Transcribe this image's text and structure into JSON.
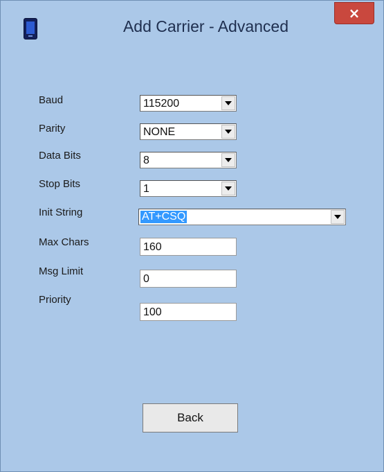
{
  "window": {
    "title": "Add Carrier - Advanced",
    "icon": "phone-app-icon",
    "close_label": "×"
  },
  "form": {
    "baud": {
      "label": "Baud",
      "value": "115200"
    },
    "parity": {
      "label": "Parity",
      "value": "NONE"
    },
    "data_bits": {
      "label": "Data Bits",
      "value": "8"
    },
    "stop_bits": {
      "label": "Stop Bits",
      "value": "1"
    },
    "init_string": {
      "label": "Init String",
      "value": "AT+CSQ"
    },
    "max_chars": {
      "label": "Max Chars",
      "value": "160"
    },
    "msg_limit": {
      "label": "Msg Limit",
      "value": "0"
    },
    "priority": {
      "label": "Priority",
      "value": "100"
    }
  },
  "buttons": {
    "back": "Back"
  },
  "colors": {
    "frame": "#abc8e8",
    "close": "#c9483e",
    "selection": "#3399ff"
  }
}
